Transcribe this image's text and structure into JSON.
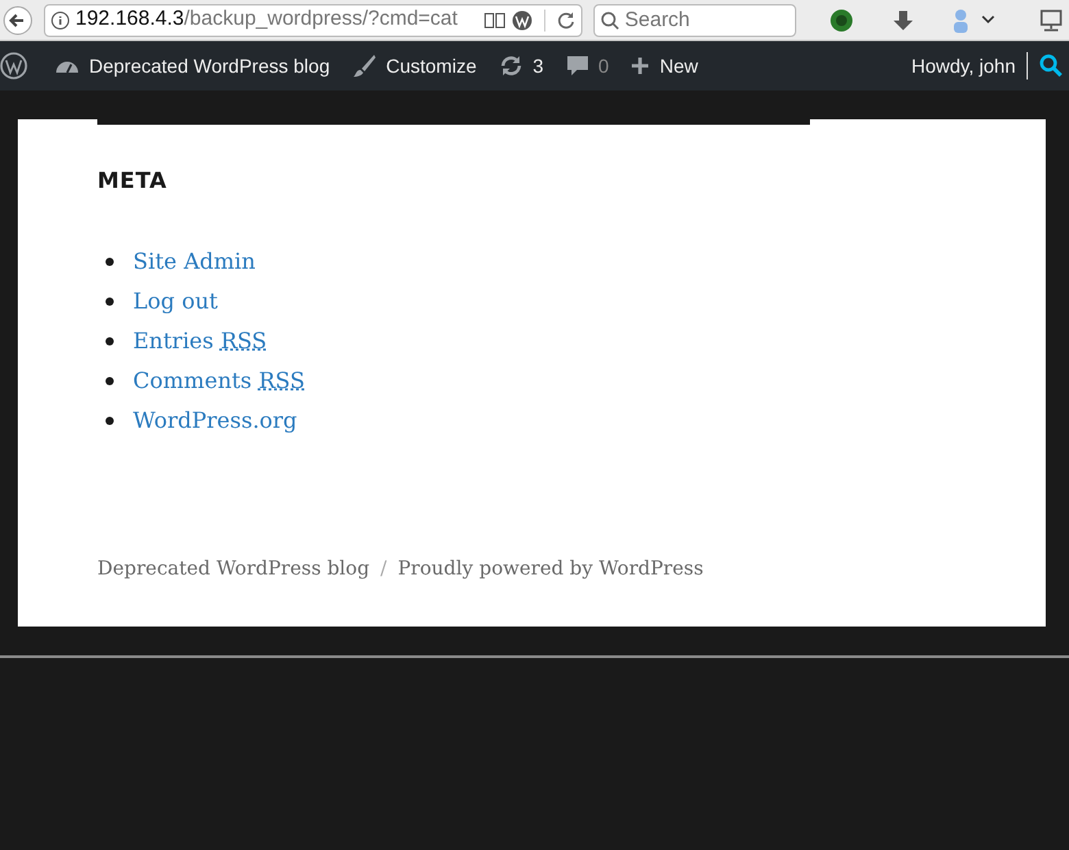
{
  "browser": {
    "url_host": "192.168.4.3",
    "url_path": "/backup_wordpress/?cmd=cat",
    "search": {
      "placeholder": "Search"
    }
  },
  "admin_bar": {
    "site_name": "Deprecated WordPress blog",
    "customize": "Customize",
    "updates": "3",
    "comments": "0",
    "new": "New",
    "greeting": "Howdy, john"
  },
  "widget": {
    "title": "META",
    "links": [
      {
        "text": "Site Admin"
      },
      {
        "text": "Log out"
      },
      {
        "text": "Entries",
        "abbr": "RSS"
      },
      {
        "text": "Comments",
        "abbr": "RSS"
      },
      {
        "text": "WordPress.org"
      }
    ]
  },
  "footer": {
    "site": "Deprecated WordPress blog",
    "separator": "/",
    "powered": "Proudly powered by WordPress"
  }
}
